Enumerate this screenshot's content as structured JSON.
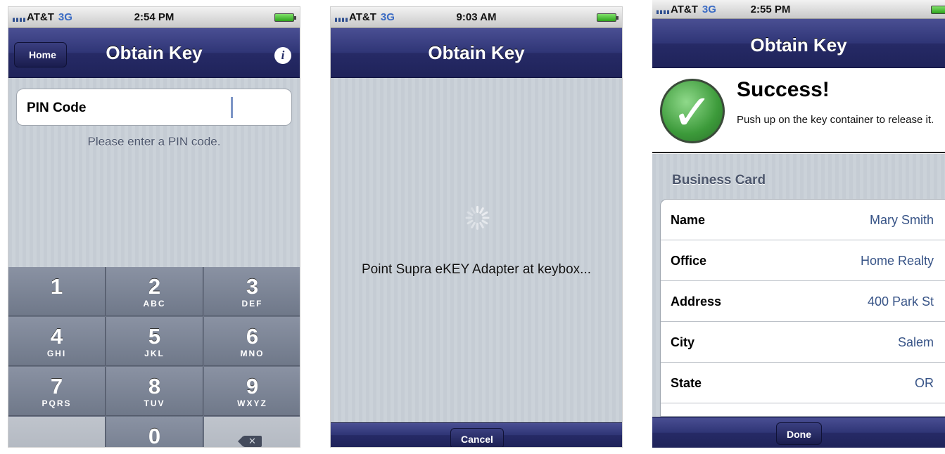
{
  "screens": [
    {
      "status": {
        "carrier": "AT&T",
        "network": "3G",
        "time": "2:54 PM"
      },
      "nav": {
        "title": "Obtain Key",
        "back_label": "Home"
      },
      "pin_field": {
        "label": "PIN Code"
      },
      "hint": "Please enter a PIN code.",
      "keypad": [
        {
          "number": "1",
          "letters": ""
        },
        {
          "number": "2",
          "letters": "ABC"
        },
        {
          "number": "3",
          "letters": "DEF"
        },
        {
          "number": "4",
          "letters": "GHI"
        },
        {
          "number": "5",
          "letters": "JKL"
        },
        {
          "number": "6",
          "letters": "MNO"
        },
        {
          "number": "7",
          "letters": "PQRS"
        },
        {
          "number": "8",
          "letters": "TUV"
        },
        {
          "number": "9",
          "letters": "WXYZ"
        },
        {
          "number": "0",
          "letters": ""
        }
      ],
      "delete_icon": "backspace-icon"
    },
    {
      "status": {
        "carrier": "AT&T",
        "network": "3G",
        "time": "9:03 AM"
      },
      "nav": {
        "title": "Obtain Key"
      },
      "message": "Point Supra eKEY Adapter at keybox...",
      "toolbar": {
        "button_label": "Cancel"
      }
    },
    {
      "status": {
        "carrier": "AT&T",
        "network": "3G",
        "time": "2:55 PM"
      },
      "nav": {
        "title": "Obtain Key"
      },
      "success": {
        "heading": "Success!",
        "text": "Push up on the key container to release it."
      },
      "section_header": "Business Card",
      "fields": [
        {
          "label": "Name",
          "value": "Mary Smith"
        },
        {
          "label": "Office",
          "value": "Home Realty"
        },
        {
          "label": "Address",
          "value": "400 Park St"
        },
        {
          "label": "City",
          "value": "Salem"
        },
        {
          "label": "State",
          "value": "OR"
        }
      ],
      "toolbar": {
        "button_label": "Done"
      }
    }
  ],
  "colors": {
    "nav_bar": "#2f3576",
    "value_text": "#385487",
    "keypad": "#6b7384",
    "background_stripe": "#c5ccd4"
  }
}
